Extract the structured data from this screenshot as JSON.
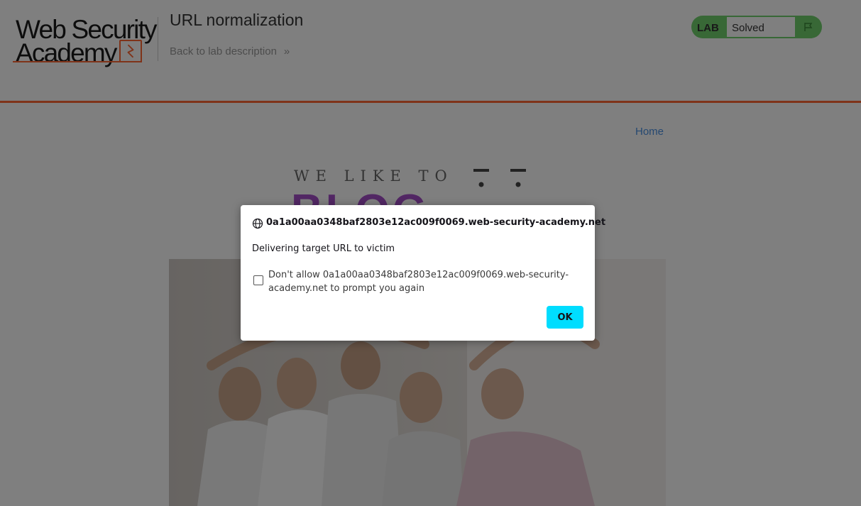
{
  "header": {
    "logo_line1": "Web Security",
    "logo_line2": "Academy",
    "lab_title": "URL normalization",
    "back_link": "Back to lab description",
    "back_chevron": "»",
    "status_label": "LAB",
    "status_value": "Solved",
    "accent_color": "#ff6633",
    "status_color": "#70d16d"
  },
  "nav": {
    "home": "Home"
  },
  "banner": {
    "top_text": "WE LIKE TO",
    "big_text": "BLOG",
    "color": "#a54fc8"
  },
  "hero": {
    "description": "group-exercise-photo"
  },
  "dialog": {
    "icon": "globe-icon",
    "origin": "0a1a00aa0348baf2803e12ac009f0069.web-security-academy.net",
    "message": "Delivering target URL to victim",
    "checkbox_label": "Don't allow 0a1a00aa0348baf2803e12ac009f0069.web-security-academy.net to prompt you again",
    "checkbox_checked": false,
    "ok_label": "OK",
    "ok_color": "#00ddff"
  }
}
